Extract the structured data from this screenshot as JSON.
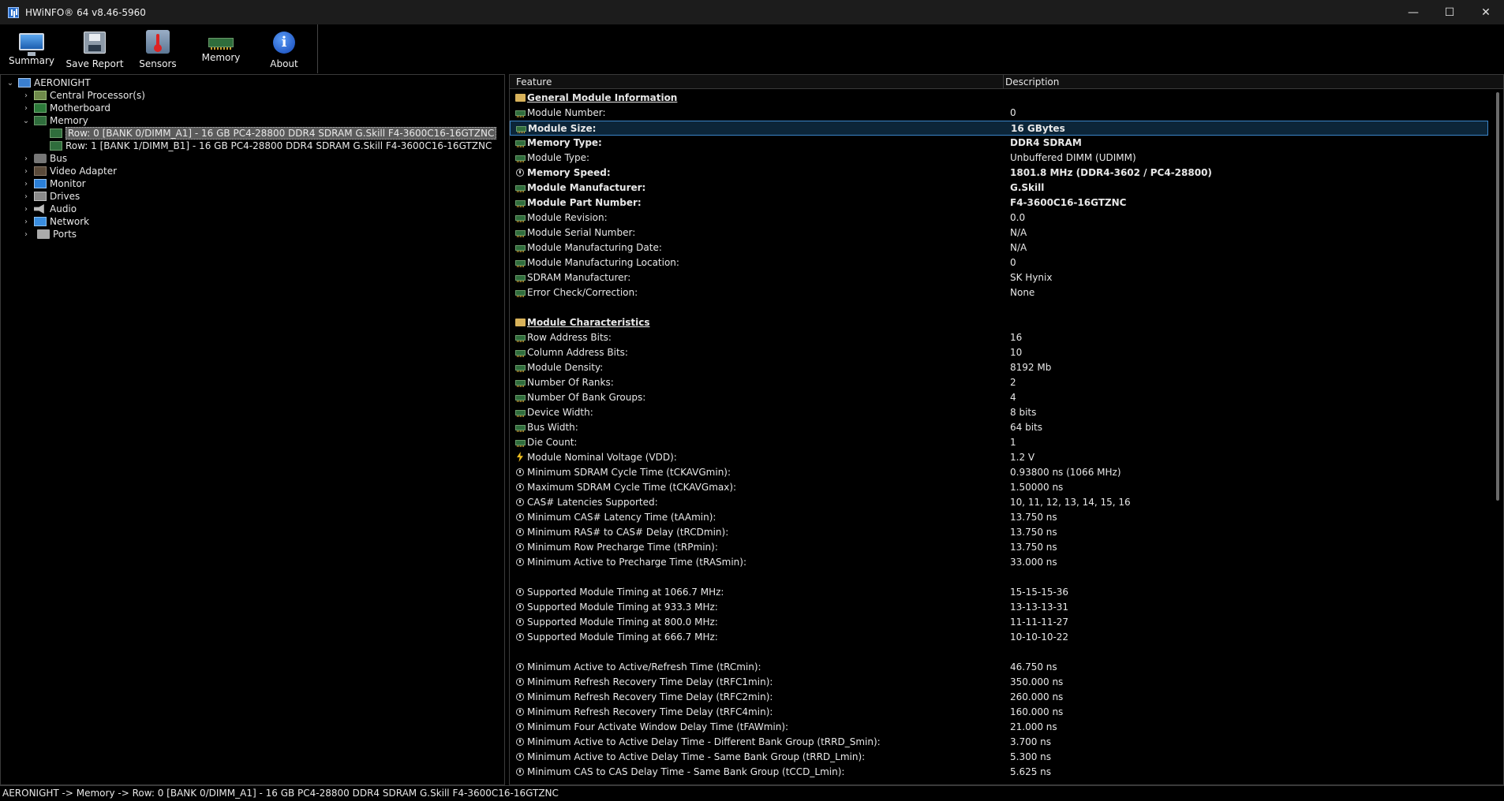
{
  "window": {
    "title": "HWiNFO® 64 v8.46-5960",
    "minimize": "—",
    "maximize": "☐",
    "close": "✕"
  },
  "toolbar": {
    "summary": "Summary",
    "save_report": "Save Report",
    "sensors": "Sensors",
    "memory": "Memory",
    "about": "About"
  },
  "tree": {
    "root": "AERONIGHT",
    "items": [
      "Central Processor(s)",
      "Motherboard",
      "Memory",
      "Row: 0 [BANK 0/DIMM_A1] - 16 GB PC4-28800 DDR4 SDRAM G.Skill F4-3600C16-16GTZNC",
      "Row: 1 [BANK 1/DIMM_B1] - 16 GB PC4-28800 DDR4 SDRAM G.Skill F4-3600C16-16GTZNC",
      "Bus",
      "Video Adapter",
      "Monitor",
      "Drives",
      "Audio",
      "Network",
      "Ports"
    ]
  },
  "details": {
    "col_feature": "Feature",
    "col_description": "Description",
    "rows": [
      {
        "f": "General Module Information",
        "v": ""
      },
      {
        "f": "Module Number:",
        "v": "0"
      },
      {
        "f": "Module Size:",
        "v": "16 GBytes"
      },
      {
        "f": "Memory Type:",
        "v": "DDR4 SDRAM"
      },
      {
        "f": "Module Type:",
        "v": "Unbuffered DIMM (UDIMM)"
      },
      {
        "f": "Memory Speed:",
        "v": "1801.8 MHz (DDR4-3602 / PC4-28800)"
      },
      {
        "f": "Module Manufacturer:",
        "v": "G.Skill"
      },
      {
        "f": "Module Part Number:",
        "v": "F4-3600C16-16GTZNC"
      },
      {
        "f": "Module Revision:",
        "v": "0.0"
      },
      {
        "f": "Module Serial Number:",
        "v": "N/A"
      },
      {
        "f": "Module Manufacturing Date:",
        "v": "N/A"
      },
      {
        "f": "Module Manufacturing Location:",
        "v": "0"
      },
      {
        "f": "SDRAM Manufacturer:",
        "v": "SK Hynix"
      },
      {
        "f": "Error Check/Correction:",
        "v": "None"
      },
      {
        "f": "Module Characteristics",
        "v": ""
      },
      {
        "f": "Row Address Bits:",
        "v": "16"
      },
      {
        "f": "Column Address Bits:",
        "v": "10"
      },
      {
        "f": "Module Density:",
        "v": "8192 Mb"
      },
      {
        "f": "Number Of Ranks:",
        "v": "2"
      },
      {
        "f": "Number Of Bank Groups:",
        "v": "4"
      },
      {
        "f": "Device Width:",
        "v": "8 bits"
      },
      {
        "f": "Bus Width:",
        "v": "64 bits"
      },
      {
        "f": "Die Count:",
        "v": "1"
      },
      {
        "f": "Module Nominal Voltage (VDD):",
        "v": "1.2 V"
      },
      {
        "f": "Minimum SDRAM Cycle Time (tCKAVGmin):",
        "v": "0.93800 ns (1066 MHz)"
      },
      {
        "f": "Maximum SDRAM Cycle Time (tCKAVGmax):",
        "v": "1.50000 ns"
      },
      {
        "f": "CAS# Latencies Supported:",
        "v": "10, 11, 12, 13, 14, 15, 16"
      },
      {
        "f": "Minimum CAS# Latency Time (tAAmin):",
        "v": "13.750 ns"
      },
      {
        "f": "Minimum RAS# to CAS# Delay (tRCDmin):",
        "v": "13.750 ns"
      },
      {
        "f": "Minimum Row Precharge Time (tRPmin):",
        "v": "13.750 ns"
      },
      {
        "f": "Minimum Active to Precharge Time (tRASmin):",
        "v": "33.000 ns"
      },
      {
        "f": "Supported Module Timing at 1066.7 MHz:",
        "v": "15-15-15-36"
      },
      {
        "f": "Supported Module Timing at 933.3 MHz:",
        "v": "13-13-13-31"
      },
      {
        "f": "Supported Module Timing at 800.0 MHz:",
        "v": "11-11-11-27"
      },
      {
        "f": "Supported Module Timing at 666.7 MHz:",
        "v": "10-10-10-22"
      },
      {
        "f": "Minimum Active to Active/Refresh Time (tRCmin):",
        "v": "46.750 ns"
      },
      {
        "f": "Minimum Refresh Recovery Time Delay (tRFC1min):",
        "v": "350.000 ns"
      },
      {
        "f": "Minimum Refresh Recovery Time Delay (tRFC2min):",
        "v": "260.000 ns"
      },
      {
        "f": "Minimum Refresh Recovery Time Delay (tRFC4min):",
        "v": "160.000 ns"
      },
      {
        "f": "Minimum Four Activate Window Delay Time (tFAWmin):",
        "v": "21.000 ns"
      },
      {
        "f": "Minimum Active to Active Delay Time - Different Bank Group (tRRD_Smin):",
        "v": "3.700 ns"
      },
      {
        "f": "Minimum Active to Active Delay Time - Same Bank Group (tRRD_Lmin):",
        "v": "5.300 ns"
      },
      {
        "f": "Minimum CAS to CAS Delay Time - Same Bank Group (tCCD_Lmin):",
        "v": "5.625 ns"
      }
    ]
  },
  "statusbar": {
    "path": "AERONIGHT -> Memory -> Row: 0 [BANK 0/DIMM_A1] - 16 GB PC4-28800 DDR4 SDRAM G.Skill F4-3600C16-16GTZNC"
  }
}
